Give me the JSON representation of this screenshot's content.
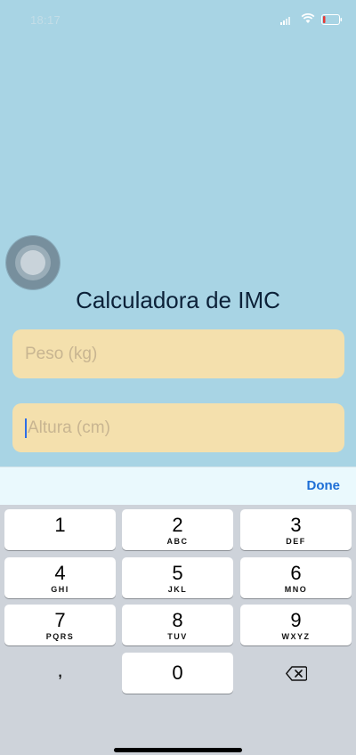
{
  "status_bar": {
    "time": "18:17",
    "icons": [
      "signal-icon",
      "wifi-icon",
      "battery-icon"
    ],
    "battery_color": "#e53935"
  },
  "app": {
    "title": "Calculadora de IMC",
    "weight_field": {
      "placeholder": "Peso (kg)",
      "value": ""
    },
    "height_field": {
      "placeholder": "Altura (cm)",
      "value": ""
    }
  },
  "keyboard": {
    "accessory": {
      "done_label": "Done"
    },
    "keys": [
      {
        "digit": "1",
        "letters": ""
      },
      {
        "digit": "2",
        "letters": "ABC"
      },
      {
        "digit": "3",
        "letters": "DEF"
      },
      {
        "digit": "4",
        "letters": "GHI"
      },
      {
        "digit": "5",
        "letters": "JKL"
      },
      {
        "digit": "6",
        "letters": "MNO"
      },
      {
        "digit": "7",
        "letters": "PQRS"
      },
      {
        "digit": "8",
        "letters": "TUV"
      },
      {
        "digit": "9",
        "letters": "WXYZ"
      }
    ],
    "comma": ",",
    "zero": "0",
    "delete_icon": "backspace-icon"
  },
  "colors": {
    "background": "#a8d4e4",
    "field_fill": "#f4e0ad",
    "title_text": "#0c2138",
    "accent": "#1d6ed6"
  }
}
